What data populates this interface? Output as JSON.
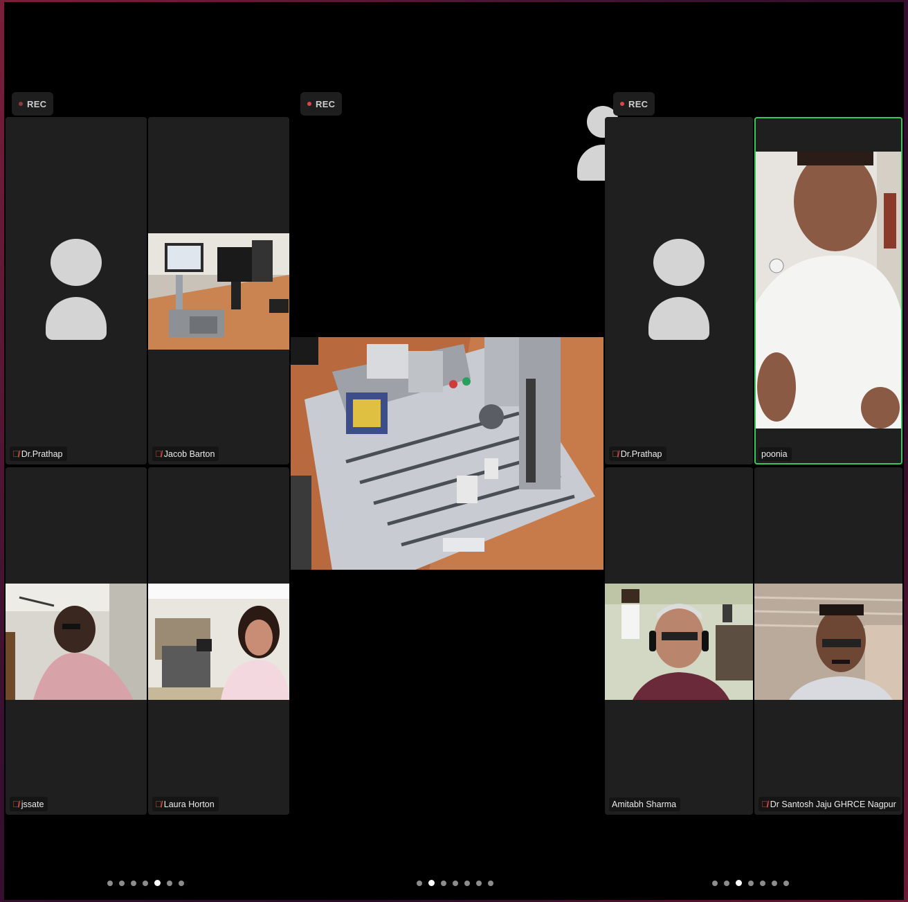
{
  "panels": [
    {
      "rec_label": "REC",
      "participants": [
        {
          "name": "Dr.Prathap",
          "muted": true,
          "video": false
        },
        {
          "name": "Jacob Barton",
          "muted": true,
          "video": true
        },
        {
          "name": "jssate",
          "muted": true,
          "video": true
        },
        {
          "name": "Laura Horton",
          "muted": true,
          "video": true
        }
      ],
      "pager": {
        "count": 7,
        "active_index": 4
      }
    },
    {
      "rec_label": "REC",
      "shared_screen": "lab-equipment-video",
      "pager": {
        "count": 7,
        "active_index": 1
      }
    },
    {
      "rec_label": "REC",
      "participants": [
        {
          "name": "Dr.Prathap",
          "muted": true,
          "video": false
        },
        {
          "name": "poonia",
          "muted": false,
          "video": true,
          "active_speaker": true
        },
        {
          "name": "Amitabh Sharma",
          "muted": false,
          "video": true
        },
        {
          "name": "Dr Santosh Jaju GHRCE Nagpur",
          "muted": true,
          "video": true
        }
      ],
      "pager": {
        "count": 7,
        "active_index": 2
      }
    }
  ],
  "icons": {
    "mute": "microphone-muted-icon",
    "avatar": "person-avatar-icon",
    "rec": "record-dot-icon"
  },
  "colors": {
    "rec_dot": "#e04545",
    "active_speaker_border": "#32c85a",
    "mute_icon": "#e04545"
  }
}
